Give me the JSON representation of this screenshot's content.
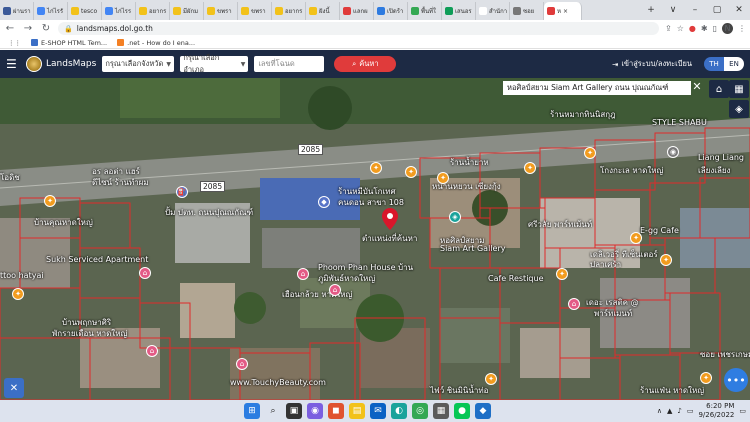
{
  "browser": {
    "tabs": [
      {
        "label": "ผ่านรา",
        "color": "#3b5998"
      },
      {
        "label": "ไก่ไรรั",
        "color": "#4285f4"
      },
      {
        "label": "tesco",
        "color": "#f2c21a"
      },
      {
        "label": "ไก่ไรร",
        "color": "#4285f4"
      },
      {
        "label": "อยากร",
        "color": "#f2c21a"
      },
      {
        "label": "มีผักม",
        "color": "#f2c21a"
      },
      {
        "label": "ขพรา",
        "color": "#f2c21a"
      },
      {
        "label": "ขพรา",
        "color": "#f2c21a"
      },
      {
        "label": "อยากร",
        "color": "#f2c21a"
      },
      {
        "label": "ฝังนี้",
        "color": "#f2c21a"
      },
      {
        "label": "แลกผ",
        "color": "#e03b3b"
      },
      {
        "label": "เปิดร้า",
        "color": "#2e7be0"
      },
      {
        "label": "พื้นที่ใ",
        "color": "#34a853"
      },
      {
        "label": "เสนอร",
        "color": "#0f9d58"
      },
      {
        "label": "สำนักา",
        "color": "#ffffff"
      },
      {
        "label": "ซอย",
        "color": "#777777"
      }
    ],
    "active_tab": {
      "label": "ห",
      "color": "#e03b3b"
    },
    "new_tab": "+",
    "window_controls": [
      "∨",
      "–",
      "▢",
      "✕"
    ],
    "url": "landsmaps.dol.go.th",
    "bookmarks": [
      {
        "label": "E-SHOP HTML Tem...",
        "color": "#3b6fc6"
      },
      {
        "label": ".net - How do I ena...",
        "color": "#f48024"
      }
    ],
    "profile_initial": "N"
  },
  "app": {
    "logo_text": "LandsMaps",
    "province_placeholder": "กรุณาเลือกจังหวัด",
    "district_placeholder": "กรุณาเลือกอำเภอ",
    "parcel_placeholder": "เลขที่โฉนด",
    "search_label": "ค้นหา",
    "login_label": "เข้าสู่ระบบ/ลงทะเบียน",
    "lang_th": "TH",
    "lang_en": "EN"
  },
  "map": {
    "infobox": "หอศิลป์สยาม Siam Art Gallery ถนน ปุณณกัณฑ์",
    "close": "✕",
    "road_shields": [
      "2085",
      "2085"
    ],
    "labels": {
      "l1": "ร้านหมากทินนิสกุฎ",
      "l2": "STYLE SHABU",
      "l3": "ร้านน้ำยาห",
      "l4": "โกงกะเล หาดใหญ่",
      "l5": "Liang Liang",
      "l6": "เลียงเลียง",
      "l7": "อร ลอต่า แฮร์",
      "l8": "ดีไซน์ ร้านทำผม",
      "l9": "ร้านหมีบันโกเทศ",
      "l10": "คนดอน สาขา 108",
      "l11": "หนานหยวน เซียงกุ้ง",
      "l12": "ปั้ม ปตท. ถนนปุณณกัณฑ์",
      "l13": "ตำแหน่งที่ค้นหา",
      "l14": "หอศิลป์สยาม",
      "l15": "Siam Art Gallery",
      "l16": "ศรีวลัย พาร์ทเม้นท์",
      "l17": "E-gg Cafe",
      "l18": "เดลิเวอรี่ ทีเซ็นเตอร์",
      "l19": "ปลาเศร้า",
      "l20": "บ้านคุณหาดใหญ่",
      "l21": "Sukh Serviced Apartment",
      "l22": "Phoom Phan House บ้าน",
      "l23": "ภูมิพันธ์หาดใหญ่",
      "l24": "Cafe Restique",
      "l25": "เฮือนกล้วย หาดใหญ่",
      "l26": "ttoo hatyai",
      "l27": "เดอะ เรสติค @",
      "l28": "พาร์ทเมนท์",
      "l29": "บ้านพฤกษาศิริ",
      "l30": "พักรายเดือน หาดใหญ่",
      "l31": "www.TouchyBeauty.com",
      "l32": "ไฟว์ ชินมินิน้ำท่อ",
      "l33": "ร้านแฟ่น หาดใหญ่",
      "l34": "ซอย เพชรเกษม",
      "l35": "โอดิช"
    }
  },
  "taskbar": {
    "time": "6:20 PM",
    "date": "9/26/2022",
    "wifi": "▲"
  }
}
